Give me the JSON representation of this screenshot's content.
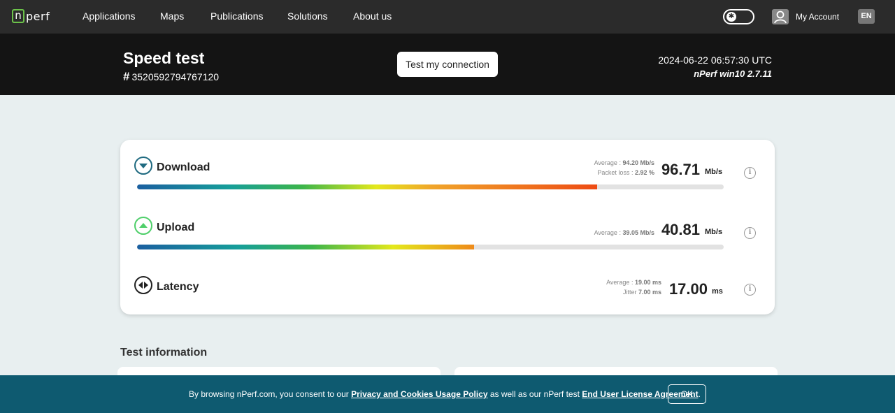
{
  "nav": {
    "logo_box": "n",
    "logo_text": "perf",
    "links": [
      "Applications",
      "Maps",
      "Publications",
      "Solutions",
      "About us"
    ],
    "account": "My Account",
    "lang": "EN"
  },
  "header": {
    "title": "Speed test",
    "hash": "#",
    "test_id": "3520592794767120",
    "test_button": "Test my connection",
    "datetime": "2024-06-22 06:57:30 UTC",
    "version": "nPerf win10 2.7.11"
  },
  "results": {
    "download": {
      "label": "Download",
      "average_label": "Average :",
      "average_value": "94.20 Mb/s",
      "loss_label": "Packet loss :",
      "loss_value": "2.92 %",
      "value": "96.71",
      "unit": "Mb/s",
      "bar_fraction": 0.784
    },
    "upload": {
      "label": "Upload",
      "average_label": "Average :",
      "average_value": "39.05 Mb/s",
      "value": "40.81",
      "unit": "Mb/s",
      "bar_fraction": 0.574
    },
    "latency": {
      "label": "Latency",
      "average_label": "Average :",
      "average_value": "19.00 ms",
      "jitter_label": "Jitter",
      "jitter_value": "7.00 ms",
      "value": "17.00",
      "unit": "ms"
    }
  },
  "section": {
    "test_information": "Test information"
  },
  "cookie": {
    "text_before": "By browsing nPerf.com, you consent to our ",
    "privacy_link": "Privacy and Cookies Usage Policy",
    "text_middle": " as well as our nPerf test ",
    "eula_link": "End User License Agreement",
    "text_after": ".",
    "ok": "OK"
  },
  "colors": {
    "nav_bg": "#2b2b2b",
    "band_bg": "#141414",
    "page_bg": "#e8eff0",
    "cookie_bg": "#0e5a70",
    "download_icon": "#1f6a80",
    "upload_icon": "#4fcf6a",
    "latency_icon": "#222222"
  },
  "icons": {
    "download": "download-arrow-icon",
    "upload": "upload-arrow-icon",
    "latency": "latency-arrows-icon",
    "info": "info-icon",
    "theme": "theme-toggle-icon",
    "avatar": "user-avatar-icon"
  }
}
